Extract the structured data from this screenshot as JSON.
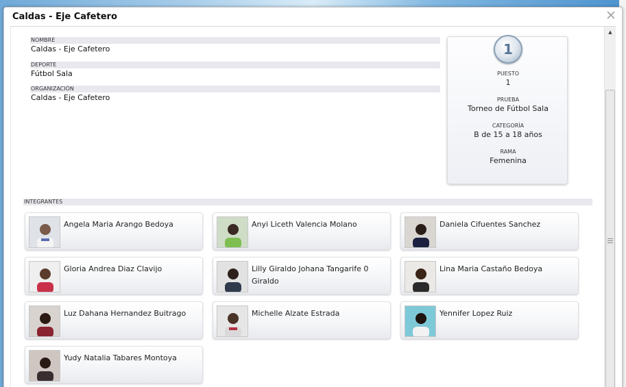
{
  "dialog": {
    "title": "Caldas - Eje Cafetero",
    "close_glyph": "✕"
  },
  "fields": {
    "nombre_label": "NOMBRE",
    "nombre_value": "Caldas - Eje Cafetero",
    "deporte_label": "DEPORTE",
    "deporte_value": "Fútbol Sala",
    "organizacion_label": "ORGANIZACIÓN",
    "organizacion_value": "Caldas - Eje Cafetero"
  },
  "ranking": {
    "medal_number": "1",
    "puesto_label": "PUESTO",
    "puesto_value": "1",
    "prueba_label": "PRUEBA",
    "prueba_value": "Torneo de Fútbol Sala",
    "categoria_label": "CATEGORÍA",
    "categoria_value": "B de 15 a 18 años",
    "rama_label": "RAMA",
    "rama_value": "Femenina"
  },
  "integrantes": {
    "label": "INTEGRANTES",
    "members": [
      {
        "name": "Angela Maria Arango Bedoya"
      },
      {
        "name": "Anyi Liceth Valencia Molano"
      },
      {
        "name": "Daniela Cifuentes Sanchez"
      },
      {
        "name": "Gloria Andrea Diaz Clavijo"
      },
      {
        "name": "Lilly Giraldo Johana Tangarife 0 Giraldo"
      },
      {
        "name": "Lina Maria Castaño Bedoya"
      },
      {
        "name": "Luz Dahana Hernandez Buitrago"
      },
      {
        "name": "Michelle Alzate Estrada"
      },
      {
        "name": "Yennifer Lopez Ruiz"
      },
      {
        "name": "Yudy Natalia Tabares Montoya"
      }
    ]
  },
  "colors": {
    "label_band": "#e8e8ee",
    "medal_blue": "#5a7696"
  }
}
